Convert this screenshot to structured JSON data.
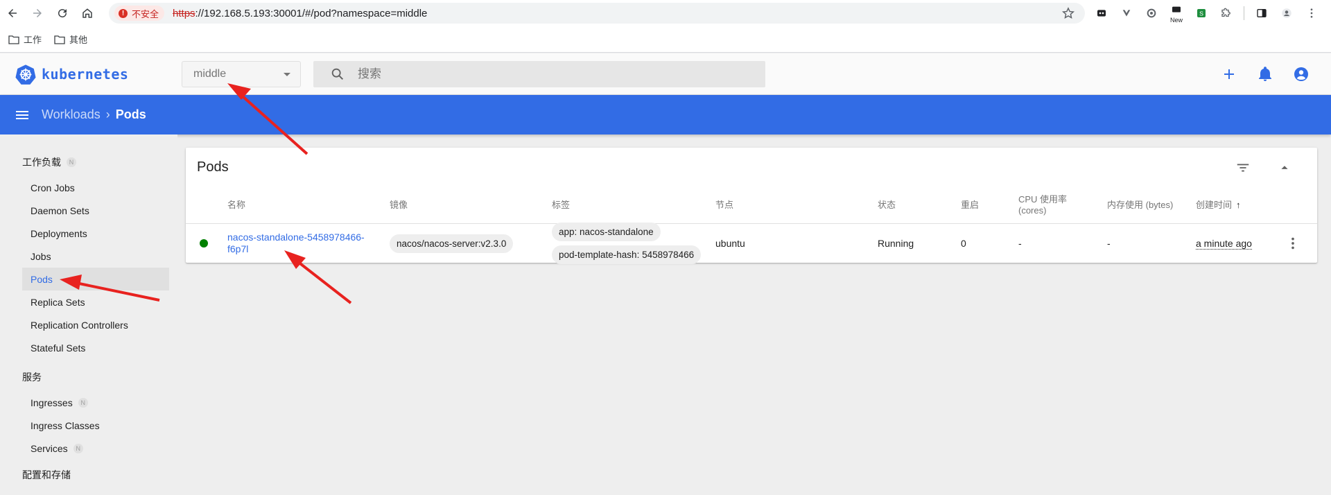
{
  "browser": {
    "insecure_label": "不安全",
    "url_scheme": "https",
    "url_rest": "://192.168.5.193:30001/#/pod?namespace=middle",
    "extensions": [
      "ext-1-icon",
      "ext-2-icon",
      "ext-3-icon",
      "ext-new-icon",
      "ext-s-icon",
      "extensions-icon"
    ],
    "new_badge": "New",
    "bookmarks": [
      {
        "label": "工作"
      },
      {
        "label": "其他"
      }
    ]
  },
  "app": {
    "brand": "kubernetes",
    "namespace": "middle",
    "search_placeholder": "搜索"
  },
  "breadcrumb": {
    "parent": "Workloads",
    "current": "Pods",
    "separator": "›"
  },
  "sidebar": {
    "sections": [
      {
        "title": "工作负载",
        "badge": "N",
        "items": [
          "Cron Jobs",
          "Daemon Sets",
          "Deployments",
          "Jobs",
          "Pods",
          "Replica Sets",
          "Replication Controllers",
          "Stateful Sets"
        ]
      },
      {
        "title": "服务",
        "items": [
          "Ingresses",
          "Ingress Classes",
          "Services"
        ],
        "item_badges": {
          "Ingresses": "N",
          "Services": "N"
        }
      },
      {
        "title": "配置和存储"
      }
    ],
    "active_item": "Pods"
  },
  "pods_card": {
    "title": "Pods",
    "columns": {
      "name": "名称",
      "image": "镜像",
      "labels": "标签",
      "node": "节点",
      "status": "状态",
      "restarts": "重启",
      "cpu_1": "CPU 使用率",
      "cpu_2": "(cores)",
      "memory": "内存使用 (bytes)",
      "created": "创建时间",
      "sort_arrow": "↑"
    },
    "rows": [
      {
        "name": "nacos-standalone-5458978466-f6p7l",
        "image": "nacos/nacos-server:v2.3.0",
        "labels": [
          "app: nacos-standalone",
          "pod-template-hash: 5458978466"
        ],
        "node": "ubuntu",
        "status": "Running",
        "restarts": "0",
        "cpu": "-",
        "memory": "-",
        "created": "a minute ago"
      }
    ]
  },
  "colors": {
    "brand_blue": "#326ce5",
    "status_running": "#008000",
    "annotation_red": "#e8221f"
  }
}
